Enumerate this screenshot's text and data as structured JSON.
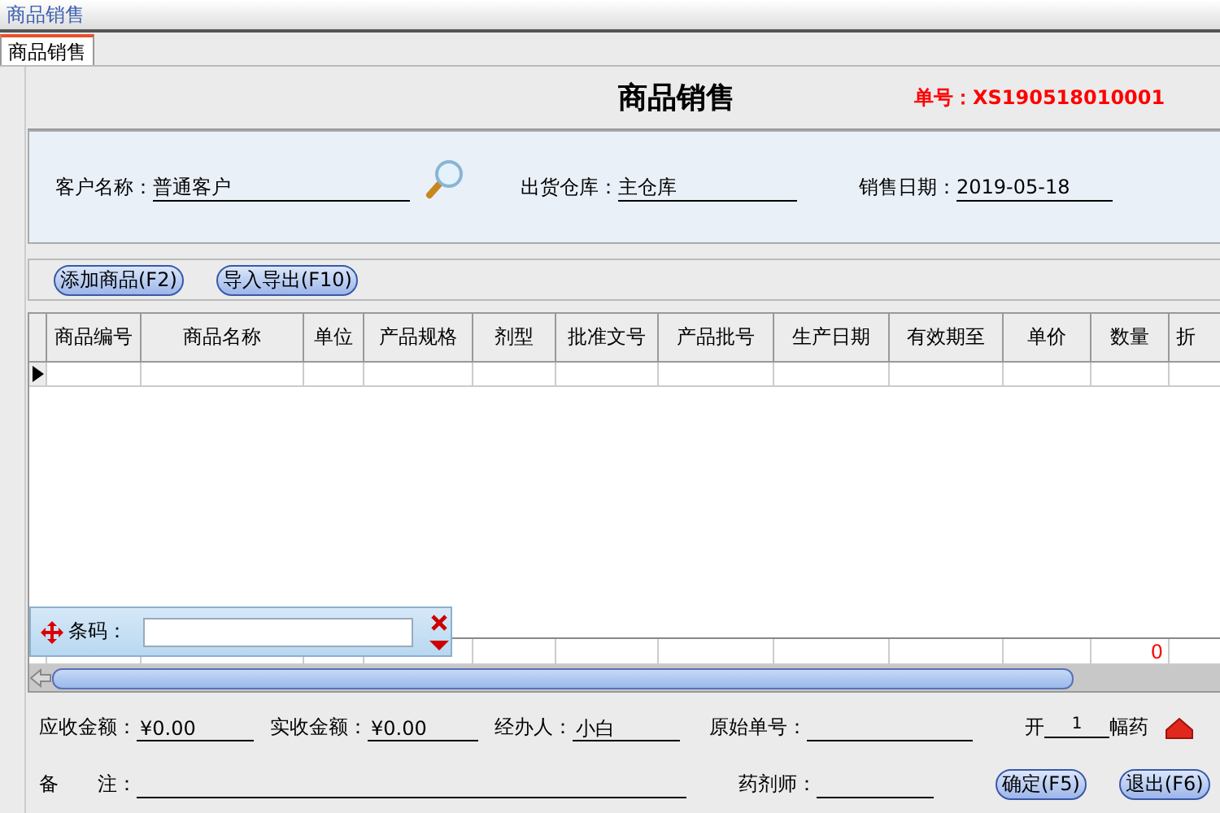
{
  "window": {
    "title": "商品销售"
  },
  "tabs": [
    {
      "label": "商品销售",
      "selected": true
    }
  ],
  "heading": "商品销售",
  "order_number": "单号：XS190518010001",
  "header_fields": [
    {
      "label": "客户名称：",
      "value": "普通客户",
      "lookup": true
    },
    {
      "label": "出货仓库：",
      "value": "主仓库",
      "lookup": false
    },
    {
      "label": "销售日期：",
      "value": "2019-05-18",
      "lookup": false
    }
  ],
  "toolbar": [
    "添加商品(F2)",
    "导入导出(F10)"
  ],
  "table": {
    "columns": [
      {
        "label": "商品编号"
      },
      {
        "label": "商品名称"
      },
      {
        "label": "单位"
      },
      {
        "label": "产品规格"
      },
      {
        "label": "剂型"
      },
      {
        "label": "批准文号"
      },
      {
        "label": "产品批号"
      },
      {
        "label": "生产日期"
      },
      {
        "label": "有效期至"
      },
      {
        "label": "单价"
      },
      {
        "label": "数量",
        "total": "0"
      },
      {
        "label": "折"
      }
    ],
    "rows": [
      {
        "selected": true
      }
    ]
  },
  "barcode": {
    "label": "条码："
  },
  "footer_fields": [
    {
      "label": "应收金额：",
      "value": "¥0.00"
    },
    {
      "label": "实收金额：",
      "value": "¥0.00"
    },
    {
      "label": "经办人：",
      "value": "小白"
    },
    {
      "label": "原始单号："
    }
  ],
  "dose": {
    "prefix": "开",
    "value": "1",
    "suffix": "幅药"
  },
  "notes": {
    "label": "备　　注："
  },
  "pharmacist": {
    "label": "药剂师："
  },
  "buttons": [
    "确定(F5)",
    "退出(F6)"
  ]
}
